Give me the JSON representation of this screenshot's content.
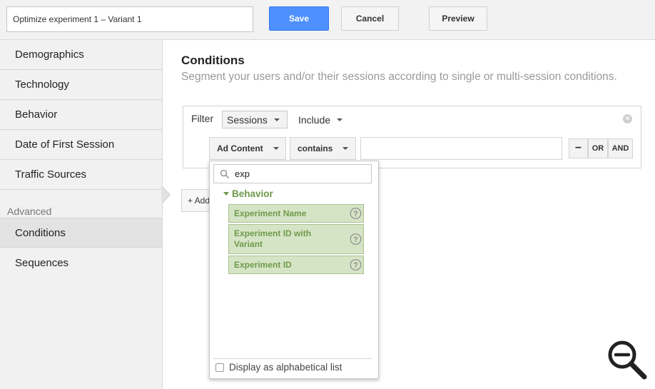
{
  "topbar": {
    "segment_name": "Optimize experiment 1 – Variant 1",
    "save_label": "Save",
    "cancel_label": "Cancel",
    "preview_label": "Preview",
    "save_color": "#4d90fe"
  },
  "sidebar": {
    "items": [
      {
        "label": "Demographics"
      },
      {
        "label": "Technology"
      },
      {
        "label": "Behavior"
      },
      {
        "label": "Date of First Session"
      },
      {
        "label": "Traffic Sources"
      }
    ],
    "advanced_caption": "Advanced",
    "advanced_items": [
      {
        "label": "Conditions",
        "active": true
      },
      {
        "label": "Sequences",
        "active": false
      }
    ]
  },
  "main": {
    "title": "Conditions",
    "subtitle": "Segment your users and/or their sessions according to single or multi-session conditions.",
    "filter": {
      "label": "Filter",
      "scope": "Sessions",
      "mode": "Include",
      "dimension": "Ad Content",
      "operator": "contains",
      "value": "",
      "minus_label": "−",
      "or_label": "OR",
      "and_label": "AND",
      "remove_icon": "close-circle-icon"
    },
    "add_label": "+ Add"
  },
  "dropdown": {
    "search_value": "exp",
    "group": "Behavior",
    "group_color": "#6f9a4c",
    "options": [
      {
        "label": "Experiment Name"
      },
      {
        "label": "Experiment ID with Variant"
      },
      {
        "label": "Experiment ID"
      }
    ],
    "alphabetical_label": "Display as alphabetical list",
    "alphabetical_checked": false
  },
  "overlay": {
    "zoom_icon": "zoom-out-icon"
  }
}
